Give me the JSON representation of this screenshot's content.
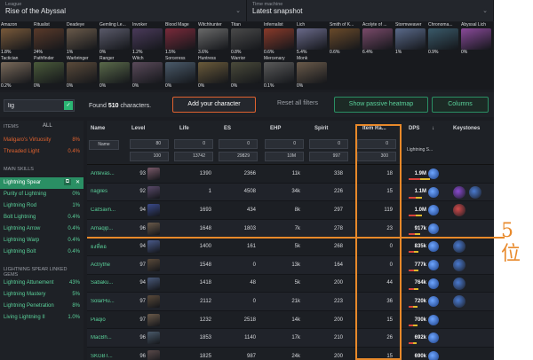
{
  "header": {
    "league_label": "League",
    "league_value": "Rise of the Abyssal",
    "time_label": "Time machine",
    "time_value": "Latest snapshot"
  },
  "classes": [
    {
      "name": "Amazon",
      "pct": "1.8%",
      "color": "#7a5a3a"
    },
    {
      "name": "Ritualist",
      "pct": "24%",
      "color": "#5a3a2a"
    },
    {
      "name": "Deadeye",
      "pct": "1%",
      "color": "#6a5a4a"
    },
    {
      "name": "Gemling Le...",
      "pct": "0%",
      "color": "#5a5a6a"
    },
    {
      "name": "Invoker",
      "pct": "1.2%",
      "color": "#4a3a5a"
    },
    {
      "name": "Blood Mage",
      "pct": "1.5%",
      "color": "#7a2a3a"
    },
    {
      "name": "Witchhunter",
      "pct": "3.6%",
      "color": "#6a6a6a"
    },
    {
      "name": "Titan",
      "pct": "0.8%",
      "color": "#4a4a4a"
    },
    {
      "name": "Infernalist",
      "pct": "0.6%",
      "color": "#8a3a2a"
    },
    {
      "name": "Lich",
      "pct": "5.4%",
      "color": "#6a6a8a"
    },
    {
      "name": "Smith of K...",
      "pct": "0.6%",
      "color": "#6a4a2a"
    },
    {
      "name": "Acolyte of ...",
      "pct": "6.4%",
      "color": "#7a4a6a"
    },
    {
      "name": "Stormweaver",
      "pct": "1%",
      "color": "#5a6a8a"
    },
    {
      "name": "Chronoma...",
      "pct": "0.9%",
      "color": "#3a5a6a"
    },
    {
      "name": "Abyssal Lich",
      "pct": "0%",
      "color": "#8a4a9a"
    },
    {
      "name": "Tactician",
      "pct": "0.2%",
      "color": "#7a6a5a"
    },
    {
      "name": "Pathfinder",
      "pct": "0%",
      "color": "#4a5a3a"
    },
    {
      "name": "Warbringer",
      "pct": "0%",
      "color": "#5a4a3a"
    },
    {
      "name": "Ranger",
      "pct": "0%",
      "color": "#5a6a4a"
    },
    {
      "name": "Witch",
      "pct": "0%",
      "color": "#5a4a5a"
    },
    {
      "name": "Sorceress",
      "pct": "0%",
      "color": "#4a5a6a"
    },
    {
      "name": "Huntress",
      "pct": "0%",
      "color": "#6a5a3a"
    },
    {
      "name": "Warrior",
      "pct": "0%",
      "color": "#4a4a3a"
    },
    {
      "name": "Mercenary",
      "pct": "0.1%",
      "color": "#5a5a5a"
    },
    {
      "name": "Monk",
      "pct": "0%",
      "color": "#6a5a4a"
    }
  ],
  "filters": {
    "search_value": "lig",
    "search_go": "✓",
    "found_prefix": "Found",
    "found_count": "510",
    "found_suffix": "characters.",
    "add_character": "Add your character",
    "reset": "Reset all filters",
    "heatmap": "Show passive heatmap",
    "columns": "Columns"
  },
  "sidebar": {
    "items_label": "ITEMS",
    "items_all": "All",
    "items": [
      {
        "label": "Maligaro's Virtuosity",
        "pct": "8%",
        "cls": "orange"
      },
      {
        "label": "Threaded Light",
        "pct": "0.4%",
        "cls": "orange"
      }
    ],
    "skills_label": "MAIN SKILLS",
    "skills": [
      {
        "label": "Lightning Spear",
        "pct": "",
        "cls": "active"
      },
      {
        "label": "Purity of Lightning",
        "pct": "0%",
        "cls": "green"
      },
      {
        "label": "Lightning Rod",
        "pct": "1%",
        "cls": "green"
      },
      {
        "label": "Bolt Lightning",
        "pct": "0.4%",
        "cls": "green"
      },
      {
        "label": "Lightning Arrow",
        "pct": "0.4%",
        "cls": "green"
      },
      {
        "label": "Lightning Warp",
        "pct": "0.4%",
        "cls": "green"
      },
      {
        "label": "Lightning Bolt",
        "pct": "0.4%",
        "cls": "green"
      }
    ],
    "linked_label": "LIGHTNING SPEAR LINKED GEMS",
    "linked": [
      {
        "label": "Lightning Attunement",
        "pct": "43%",
        "cls": "green"
      },
      {
        "label": "Lightning Mastery",
        "pct": "5%",
        "cls": "green"
      },
      {
        "label": "Lightning Penetration",
        "pct": "8%",
        "cls": "green"
      },
      {
        "label": "Living Lightning II",
        "pct": "1.0%",
        "cls": "green"
      }
    ]
  },
  "table": {
    "headers": {
      "name": "Name",
      "level": "Level",
      "life": "Life",
      "es": "ES",
      "ehp": "EHP",
      "spirit": "Spirit",
      "item": "Item Ra...",
      "dps": "DPS",
      "keystones": "Keystones"
    },
    "filter_name": "Name",
    "filter_lightning": "Lightning S...",
    "filters": {
      "level_min": "80",
      "level_max": "100",
      "life_min": "0",
      "life_max": "13742",
      "es_min": "0",
      "es_max": "29829",
      "ehp_min": "0",
      "ehp_max": "10M",
      "spirit_min": "0",
      "spirit_max": "997",
      "item_min": "0",
      "item_max": "300"
    },
    "rows": [
      {
        "name": "Antevas...",
        "level": "93",
        "life": "1390",
        "es": "2366",
        "ehp": "11k",
        "spirit": "338",
        "item": "18",
        "dps": "1.9M",
        "bar": 0.9,
        "ava": "#7a5a6a",
        "ks": []
      },
      {
        "name": "nagiles",
        "level": "92",
        "life": "1",
        "es": "4508",
        "ehp": "34k",
        "spirit": "226",
        "item": "15",
        "dps": "1.1M",
        "bar": 0.6,
        "ava": "#5a4a6a",
        "ks": [
          "#8a4ad0",
          "#4a7ad0"
        ]
      },
      {
        "name": "CatSavn...",
        "level": "94",
        "life": "1693",
        "es": "434",
        "ehp": "8k",
        "spirit": "297",
        "item": "119",
        "dps": "1.0M",
        "bar": 0.55,
        "ava": "#3a4a8a",
        "ks": [
          "#d04a4a"
        ]
      },
      {
        "name": "Amaqip...",
        "level": "96",
        "life": "1648",
        "es": "1803",
        "ehp": "7k",
        "spirit": "278",
        "item": "23",
        "dps": "917k",
        "bar": 0.5,
        "ava": "#6a5a4a",
        "ks": []
      },
      {
        "name": "ยงที่ตอ",
        "level": "94",
        "life": "1400",
        "es": "161",
        "ehp": "5k",
        "spirit": "268",
        "item": "0",
        "dps": "835k",
        "bar": 0.45,
        "ava": "#4a5a8a",
        "ks": [
          "#4a7ad0"
        ]
      },
      {
        "name": "Actrythe",
        "level": "97",
        "life": "1548",
        "es": "0",
        "ehp": "13k",
        "spirit": "164",
        "item": "0",
        "dps": "777k",
        "bar": 0.42,
        "ava": "#5a4a3a",
        "ks": [
          "#4a7ad0"
        ]
      },
      {
        "name": "Sabaku...",
        "level": "94",
        "life": "1418",
        "es": "48",
        "ehp": "5k",
        "spirit": "200",
        "item": "44",
        "dps": "764k",
        "bar": 0.41,
        "ava": "#4a5a7a",
        "ks": [
          "#4a7ad0"
        ]
      },
      {
        "name": "SolarHu...",
        "level": "97",
        "life": "2112",
        "es": "0",
        "ehp": "21k",
        "spirit": "223",
        "item": "36",
        "dps": "720k",
        "bar": 0.39,
        "ava": "#5a4a3a",
        "ks": [
          "#4a7ad0"
        ]
      },
      {
        "name": "Piaqio",
        "level": "97",
        "life": "1232",
        "es": "2518",
        "ehp": "14k",
        "spirit": "200",
        "item": "15",
        "dps": "700k",
        "bar": 0.38,
        "ava": "#6a5a4a",
        "ks": []
      },
      {
        "name": "MacBh...",
        "level": "96",
        "life": "1853",
        "es": "1140",
        "ehp": "17k",
        "spirit": "210",
        "item": "26",
        "dps": "692k",
        "bar": 0.37,
        "ava": "#4a5a6a",
        "ks": []
      },
      {
        "name": "SKGBT...",
        "level": "96",
        "life": "1825",
        "es": "987",
        "ehp": "24k",
        "spirit": "200",
        "item": "15",
        "dps": "690k",
        "bar": 0.37,
        "ava": "#5a4a4a",
        "ks": []
      }
    ]
  },
  "annotation": {
    "text_line1": "5",
    "text_line2": "位",
    "color": "#e8892a"
  }
}
